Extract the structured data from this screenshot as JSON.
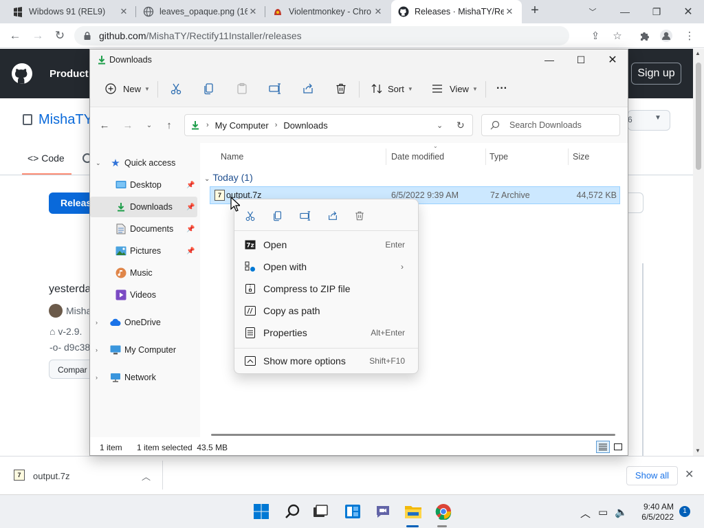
{
  "browser": {
    "tabs": [
      {
        "title": "Wibdows 91 (REL9)",
        "icon": "windows-logo-icon"
      },
      {
        "title": "leaves_opaque.png (16",
        "icon": "globe-icon"
      },
      {
        "title": "Violentmonkey - Chro",
        "icon": "violentmonkey-icon"
      },
      {
        "title": "Releases · MishaTY/Re",
        "icon": "github-icon"
      }
    ],
    "url_host": "github.com",
    "url_path": "/MishaTY/Rectify11Installer/releases"
  },
  "github": {
    "product_label": "Product",
    "signup_label": "Sign up",
    "repo_name": "MishaTY",
    "tab_code": "Code",
    "release_btn": "Releas",
    "yesterday": "yesterda",
    "author": "Misha",
    "tag": "v-2.9.",
    "commit": "d9c38",
    "compare": "Compar",
    "count_badge": "6"
  },
  "downloads_bar": {
    "file": "output.7z",
    "show_all": "Show all"
  },
  "explorer": {
    "title": "Downloads",
    "commands": {
      "new": "New",
      "sort": "Sort",
      "view": "View",
      "more": "···"
    },
    "breadcrumb": [
      "My Computer",
      "Downloads"
    ],
    "search_placeholder": "Search Downloads",
    "nav": {
      "quick_access": "Quick access",
      "desktop": "Desktop",
      "downloads": "Downloads",
      "documents": "Documents",
      "pictures": "Pictures",
      "music": "Music",
      "videos": "Videos",
      "onedrive": "OneDrive",
      "my_computer": "My Computer",
      "network": "Network"
    },
    "columns": {
      "name": "Name",
      "date": "Date modified",
      "type": "Type",
      "size": "Size"
    },
    "group": "Today (1)",
    "files": [
      {
        "name": "output.7z",
        "date": "6/5/2022 9:39 AM",
        "type": "7z Archive",
        "size": "44,572 KB"
      }
    ],
    "status": {
      "count": "1 item",
      "selected": "1 item selected  43.5 MB"
    }
  },
  "context_menu": {
    "items": [
      {
        "label": "Open",
        "shortcut": "Enter",
        "icon": "7z-icon"
      },
      {
        "label": "Open with",
        "shortcut": "",
        "icon": "open-with-icon"
      },
      {
        "label": "Compress to ZIP file",
        "shortcut": "",
        "icon": "zip-icon"
      },
      {
        "label": "Copy as path",
        "shortcut": "",
        "icon": "copy-path-icon"
      },
      {
        "label": "Properties",
        "shortcut": "Alt+Enter",
        "icon": "properties-icon"
      },
      {
        "label": "Show more options",
        "shortcut": "Shift+F10",
        "icon": "more-options-icon"
      }
    ]
  },
  "taskbar": {
    "time": "9:40 AM",
    "date": "6/5/2022",
    "notifications": "1"
  }
}
